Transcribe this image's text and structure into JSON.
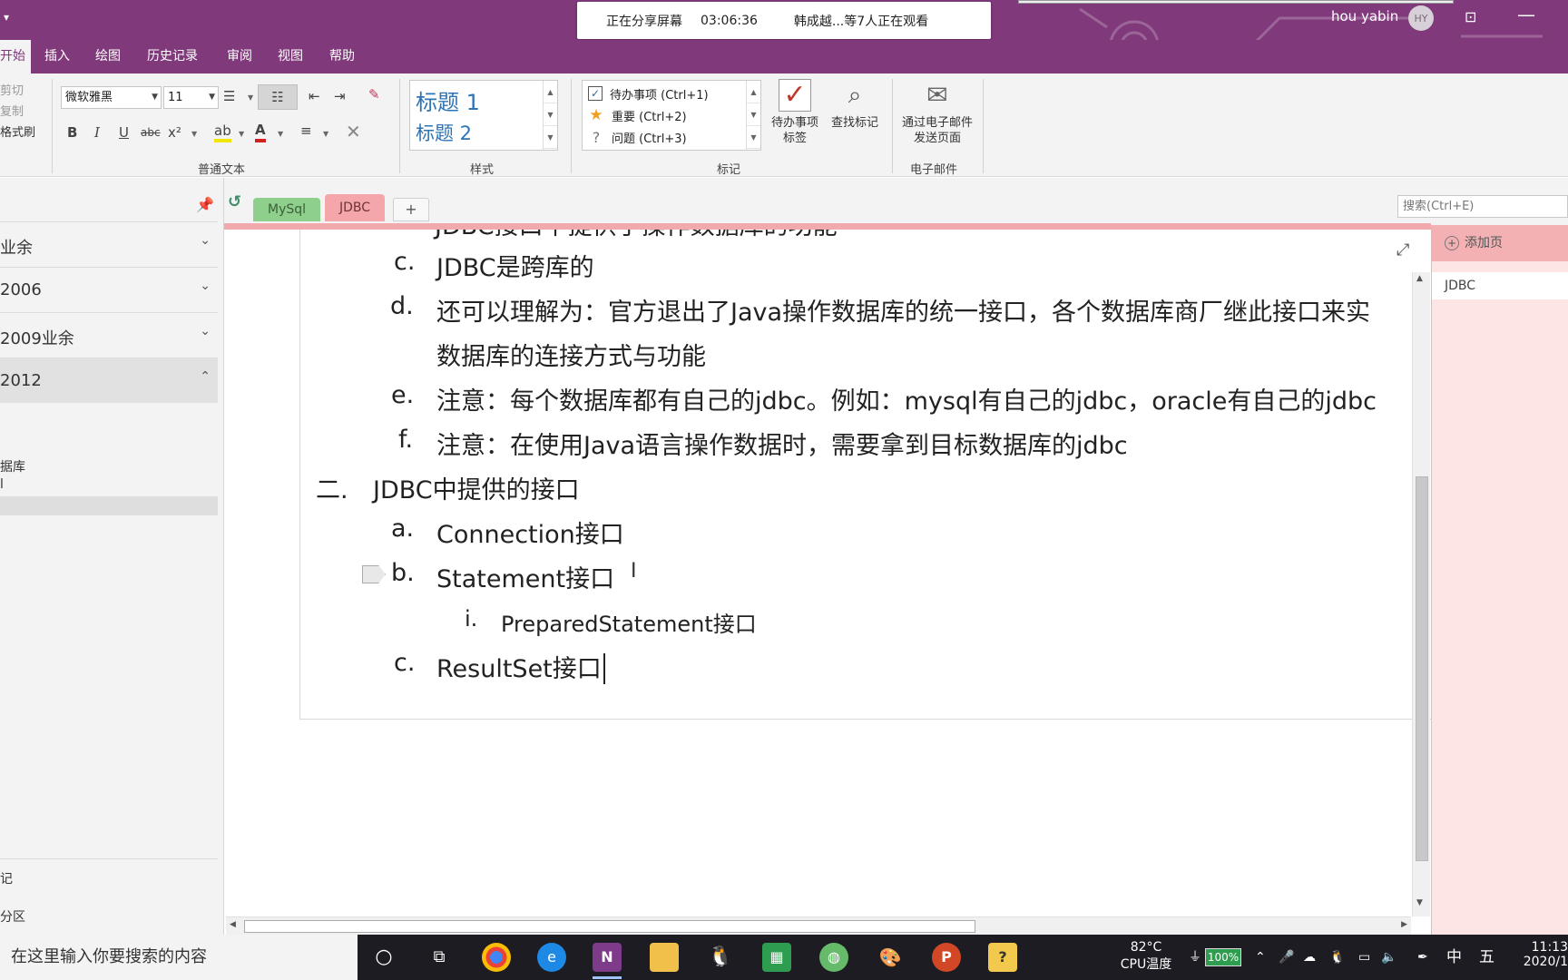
{
  "titlebar": {
    "share_status": "正在分享屏幕",
    "share_time": "03:06:36",
    "share_viewers": "韩成越...等7人正在观看",
    "user_name": "hou yabin",
    "avatar_initials": "HY"
  },
  "menu": {
    "tabs": [
      "开始",
      "插入",
      "绘图",
      "历史记录",
      "审阅",
      "视图",
      "帮助"
    ],
    "active": "开始"
  },
  "ribbon": {
    "clipboard": {
      "cut": "剪切",
      "copy": "复制",
      "format_painter": "格式刷"
    },
    "font_name": "微软雅黑",
    "font_size": "11",
    "group_basic_text": "普通文本",
    "styles": {
      "heading1": "标题 1",
      "heading2": "标题 2",
      "group_label": "样式"
    },
    "tags": {
      "todo": "待办事项 (Ctrl+1)",
      "important": "重要 (Ctrl+2)",
      "question": "问题 (Ctrl+3)",
      "todo_tag_btn": "待办事项标签",
      "find_tags_btn": "查找标记",
      "group_label": "标记"
    },
    "email": {
      "send_btn": "通过电子邮件发送页面",
      "group_label": "电子邮件"
    }
  },
  "nav": {
    "notebooks": [
      {
        "label": "业余",
        "state": "collapsed"
      },
      {
        "label": "2006",
        "state": "collapsed"
      },
      {
        "label": "2009业余",
        "state": "collapsed"
      },
      {
        "label": "2012",
        "state": "expanded"
      }
    ],
    "sections": [
      "据库",
      "l"
    ],
    "bottom": [
      "记",
      "分区"
    ]
  },
  "section_tabs": {
    "tabs": [
      "MySql",
      "JDBC"
    ],
    "active": "JDBC",
    "add": "+"
  },
  "search": {
    "placeholder": "搜索(Ctrl+E)"
  },
  "page_panel": {
    "add_page": "添加页",
    "pages": [
      "JDBC"
    ]
  },
  "note": {
    "cut_top": "JDBC接口中提供了操作数据库的功能",
    "items": [
      {
        "marker": "c.",
        "text": "JDBC是跨库的"
      },
      {
        "marker": "d.",
        "text": "还可以理解为：官方退出了Java操作数据库的统一接口，各个数据库商厂继此接口来实",
        "cont": "数据库的连接方式与功能"
      },
      {
        "marker": "e.",
        "text": "注意：每个数据库都有自己的jdbc。例如：mysql有自己的jdbc，oracle有自己的jdbc"
      },
      {
        "marker": "f.",
        "text": "注意：在使用Java语言操作数据时，需要拿到目标数据库的jdbc"
      }
    ],
    "heading2_marker": "二.",
    "heading2_text": "JDBC中提供的接口",
    "sub_items": [
      {
        "marker": "a.",
        "text": "Connection接口"
      },
      {
        "marker": "b.",
        "text": "Statement接口"
      },
      {
        "marker": "i.",
        "text": "PreparedStatement接口"
      },
      {
        "marker": "c.",
        "text": "ResultSet接口"
      }
    ]
  },
  "taskbar": {
    "search_placeholder": "在这里输入你要搜索的内容",
    "cpu_temp": "82°C",
    "cpu_label": "CPU温度",
    "battery": "100%",
    "ime1": "中",
    "ime2": "五",
    "time": "11:13",
    "date": "2020/1"
  },
  "colors": {
    "onenote_purple": "#80397b",
    "tab_mysql": "#8dcf8b",
    "tab_jdbc": "#f4a6aa",
    "page_panel": "#fde4e5"
  }
}
